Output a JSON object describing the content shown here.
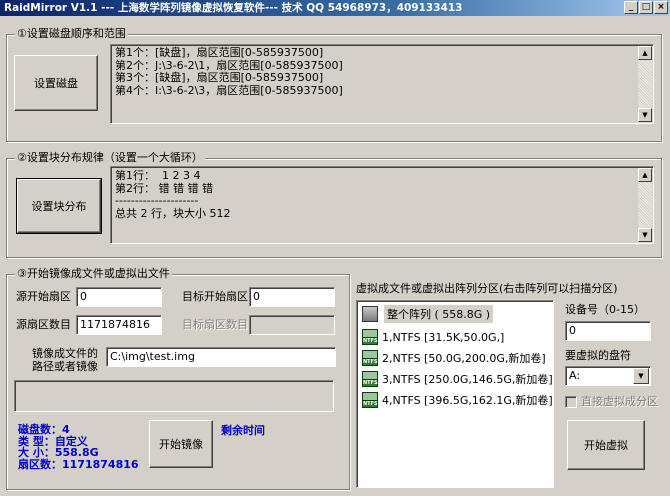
{
  "window": {
    "title": "RaidMirror V1.1 --- 上海数学阵列镜像虚拟恢复软件--- 技术 QQ 54968973，409133413",
    "min": "_",
    "max": "□",
    "close": "×"
  },
  "group1": {
    "title": "①设置磁盘顺序和范围",
    "button": "设置磁盘",
    "lines": [
      "第1个：[缺盘]，扇区范围[0-585937500]",
      "第2个：J:\\3-6-2\\1，扇区范围[0-585937500]",
      "第3个：[缺盘]，扇区范围[0-585937500]",
      "第4个：I:\\3-6-2\\3，扇区范围[0-585937500]"
    ]
  },
  "group2": {
    "title": "②设置块分布规律（设置一个大循环）",
    "button": "设置块分布",
    "lines": [
      "第1行：  1 2 3 4",
      "第2行： 错 错 错 错",
      "---------------------",
      "总共 2 行，块大小 512"
    ]
  },
  "group3": {
    "title": "③开始镜像成文件或虚拟出文件",
    "src_start_label": "源开始扇区",
    "src_start_value": "0",
    "src_count_label": "源扇区数目",
    "src_count_value": "1171874816",
    "dst_start_label": "目标开始扇区",
    "dst_start_value": "0",
    "dst_count_label": "目标扇区数目",
    "dst_count_value": "",
    "image_path_label_1": "镜像成文件的",
    "image_path_label_2": "路径或者镜像",
    "image_path_value": "C:\\img\\test.img",
    "start_mirror_button": "开始镜像",
    "remaining_time_label": "剩余时间",
    "summary": {
      "disk_count": "磁盘数：4",
      "type": "类  型：自定义",
      "size": "大  小：558.8G",
      "sectors": "扇区数：1171874816"
    }
  },
  "virtual": {
    "title": "虚拟成文件或虚拟出阵列分区(右击阵列可以扫描分区)",
    "whole_array": "整个阵列 ( 558.8G )",
    "partitions": [
      "1,NTFS [31.5K,50.0G,]",
      "2,NTFS [50.0G,200.0G,新加卷]",
      "3,NTFS [250.0G,146.5G,新加卷]",
      "4,NTFS [396.5G,162.1G,新加卷]"
    ],
    "ntfs_icon_text": "NTFS",
    "device_label": "设备号（0-15）",
    "device_value": "0",
    "drive_label": "要虚拟的盘符",
    "drive_value": "A:",
    "direct_label": "直接虚拟成分区",
    "start_virtual_button": "开始虚拟"
  },
  "colors": {
    "face": "#d4d0c8",
    "summary_text": "#0000cc",
    "title_bar": "#0a246a"
  }
}
